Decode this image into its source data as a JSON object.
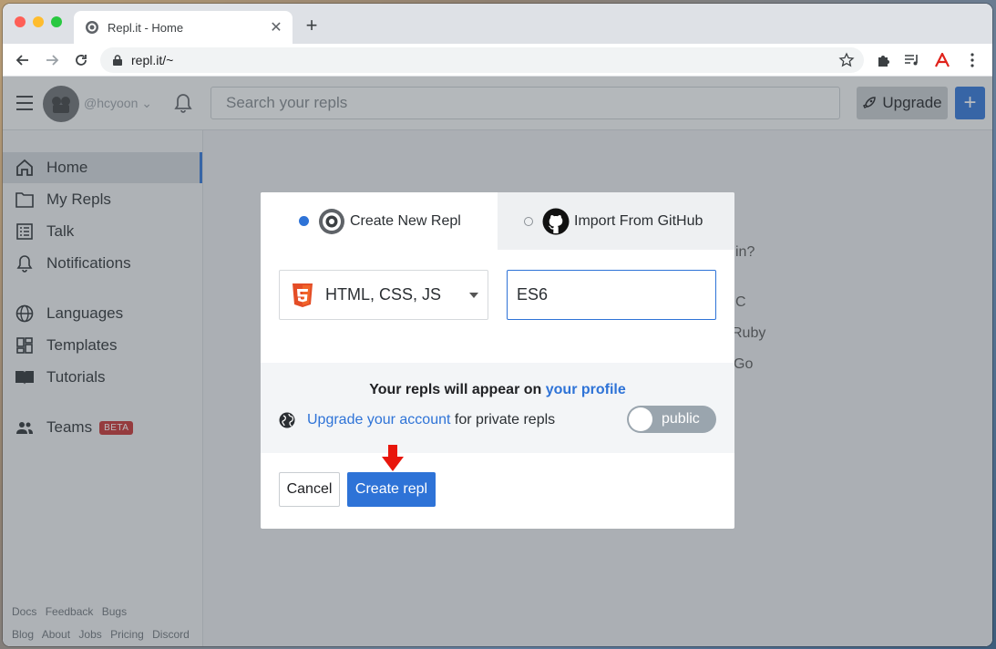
{
  "browser": {
    "tab_title": "Repl.it - Home",
    "url": "repl.it/~"
  },
  "app": {
    "username": "@hcyoon",
    "search_placeholder": "Search your repls",
    "upgrade_label": "Upgrade",
    "new_repl_label": "+"
  },
  "sidebar": {
    "items": [
      {
        "label": "Home",
        "icon": "home-icon"
      },
      {
        "label": "My Repls",
        "icon": "folder-icon"
      },
      {
        "label": "Talk",
        "icon": "list-icon"
      },
      {
        "label": "Notifications",
        "icon": "bell-icon"
      },
      {
        "label": "Languages",
        "icon": "globe-icon"
      },
      {
        "label": "Templates",
        "icon": "grid-icon"
      },
      {
        "label": "Tutorials",
        "icon": "book-icon"
      },
      {
        "label": "Teams",
        "icon": "users-icon"
      }
    ],
    "beta_badge": "BETA",
    "footer_row1": [
      "Docs",
      "Feedback",
      "Bugs"
    ],
    "footer_row2": [
      "Blog",
      "About",
      "Jobs",
      "Pricing",
      "Discord"
    ]
  },
  "background": {
    "fragments": [
      "in?",
      "C",
      "Ruby",
      "Go"
    ]
  },
  "modal": {
    "tab_create": "Create New Repl",
    "tab_import": "Import From GitHub",
    "language": "HTML, CSS, JS",
    "repl_name": "ES6",
    "info_title_prefix": "Your repls will appear on ",
    "info_title_link": "your profile",
    "upgrade_link": "Upgrade your account",
    "upgrade_suffix": " for private repls",
    "visibility": "public",
    "cancel_label": "Cancel",
    "create_label": "Create repl"
  },
  "colors": {
    "accent": "#2e73d7",
    "annotation_arrow": "#e8160c",
    "beta_badge": "#c53030",
    "html5": "#e44d26"
  }
}
